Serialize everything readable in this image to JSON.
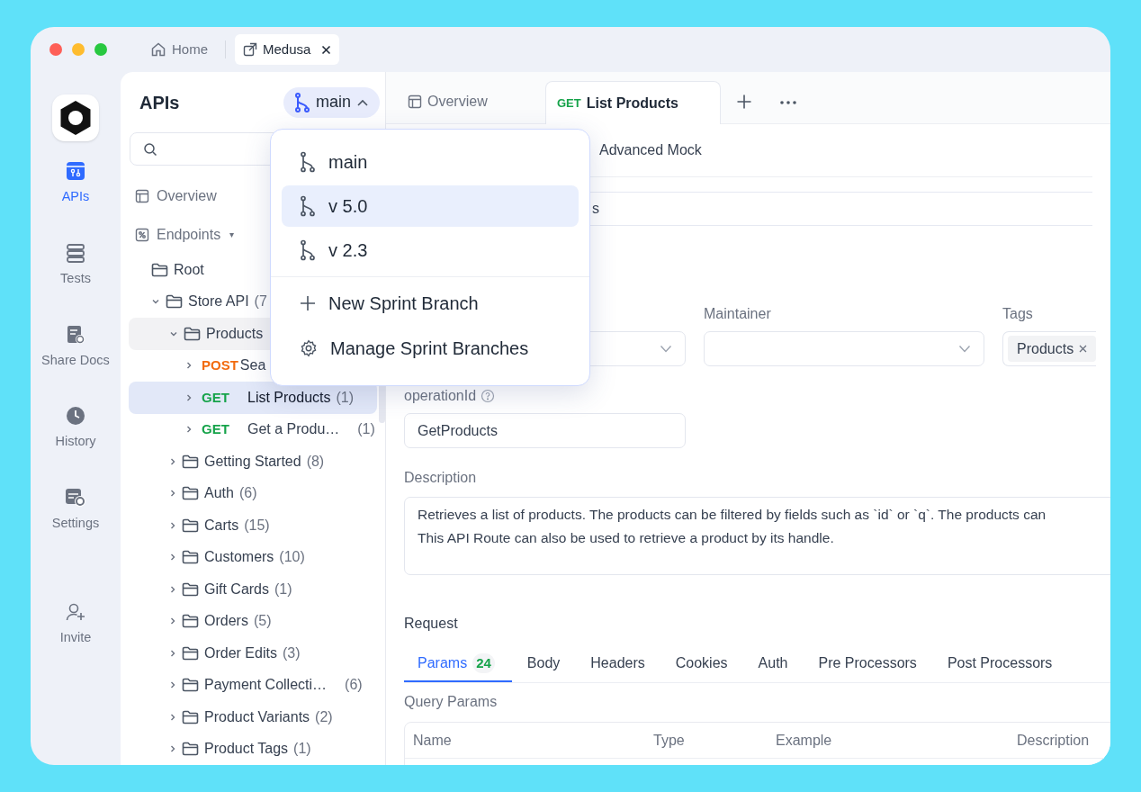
{
  "window_tabs": [
    {
      "label": "Home",
      "selected": false
    },
    {
      "label": "Medusa",
      "selected": true
    }
  ],
  "rail": [
    {
      "label": "APIs",
      "selected": true
    },
    {
      "label": "Tests",
      "selected": false
    },
    {
      "label": "Share Docs",
      "selected": false
    },
    {
      "label": "History",
      "selected": false
    },
    {
      "label": "Settings",
      "selected": false
    },
    {
      "label": "Invite",
      "selected": false
    }
  ],
  "sidebar": {
    "title": "APIs",
    "branch": "main",
    "nav": [
      {
        "label": "Overview"
      },
      {
        "label": "Endpoints",
        "caret": "▾"
      }
    ],
    "tree": [
      {
        "kind": "folder",
        "label": "Root",
        "selected": false
      },
      {
        "kind": "folder",
        "label": "Store API",
        "count": "(7",
        "expanded": true,
        "selected": false,
        "children": [
          {
            "kind": "folder",
            "label": "Products",
            "expanded": true,
            "hovered": true,
            "selected": false,
            "children": [
              {
                "kind": "endpoint",
                "method": "POST",
                "color": "#f26b0f",
                "label": "Sea",
                "expanded": false,
                "selected": false
              },
              {
                "kind": "endpoint",
                "method": "GET",
                "color": "#16a34a",
                "label": "List Products",
                "count": "(1)",
                "expanded": false,
                "selected": true
              },
              {
                "kind": "endpoint",
                "method": "GET",
                "color": "#16a34a",
                "label": "Get a Produ…",
                "count": "(1)",
                "expanded": false,
                "selected": false
              }
            ]
          },
          {
            "kind": "folder",
            "label": "Getting Started",
            "count": "(8)",
            "expanded": false,
            "selected": false
          },
          {
            "kind": "folder",
            "label": "Auth",
            "count": "(6)",
            "expanded": false,
            "selected": false
          },
          {
            "kind": "folder",
            "label": "Carts",
            "count": "(15)",
            "expanded": false,
            "selected": false
          },
          {
            "kind": "folder",
            "label": "Customers",
            "count": "(10)",
            "expanded": false,
            "selected": false
          },
          {
            "kind": "folder",
            "label": "Gift Cards",
            "count": "(1)",
            "expanded": false,
            "selected": false
          },
          {
            "kind": "folder",
            "label": "Orders",
            "count": "(5)",
            "expanded": false,
            "selected": false
          },
          {
            "kind": "folder",
            "label": "Order Edits",
            "count": "(3)",
            "expanded": false,
            "selected": false
          },
          {
            "kind": "folder",
            "label": "Payment Collecti…",
            "count": "(6)",
            "expanded": false,
            "selected": false
          },
          {
            "kind": "folder",
            "label": "Product Variants",
            "count": "(2)",
            "expanded": false,
            "selected": false
          },
          {
            "kind": "folder",
            "label": "Product Tags",
            "count": "(1)",
            "expanded": false,
            "selected": false
          }
        ]
      }
    ]
  },
  "branch_menu": {
    "branches": [
      {
        "label": "main",
        "selected": false
      },
      {
        "label": "v 5.0",
        "selected": true
      },
      {
        "label": "v 2.3",
        "selected": false
      }
    ],
    "actions": [
      {
        "label": "New Sprint Branch"
      },
      {
        "label": "Manage Sprint Branches"
      }
    ]
  },
  "main": {
    "tabs": [
      {
        "kind": "page",
        "label": "Overview",
        "selected": false
      },
      {
        "kind": "endpoint",
        "method": "GET",
        "color": "#16a34a",
        "label": "List Products",
        "selected": true
      }
    ],
    "subtabs": [
      {
        "label": "Advanced Mock"
      }
    ],
    "path_field": {
      "value": "s"
    },
    "selects": [
      {
        "kind": "select"
      },
      {
        "kind": "select",
        "label": "Maintainer"
      },
      {
        "kind": "tags",
        "label": "Tags",
        "tags": [
          "Products"
        ]
      }
    ],
    "operation_id": {
      "label": "operationId",
      "value": "GetProducts"
    },
    "description": {
      "label": "Description",
      "value": "Retrieves a list of products. The products can be filtered by fields such as `id` or `q`. The products can\nThis API Route can also be used to retrieve a product by its handle."
    },
    "request": {
      "title": "Request",
      "tabs": [
        {
          "label": "Params",
          "badge": "24",
          "selected": true
        },
        {
          "label": "Body",
          "selected": false
        },
        {
          "label": "Headers",
          "selected": false
        },
        {
          "label": "Cookies",
          "selected": false
        },
        {
          "label": "Auth",
          "selected": false
        },
        {
          "label": "Pre Processors",
          "selected": false
        },
        {
          "label": "Post Processors",
          "selected": false
        }
      ],
      "section": "Query Params",
      "columns": [
        "Name",
        "Type",
        "Example",
        "Description"
      ]
    }
  }
}
